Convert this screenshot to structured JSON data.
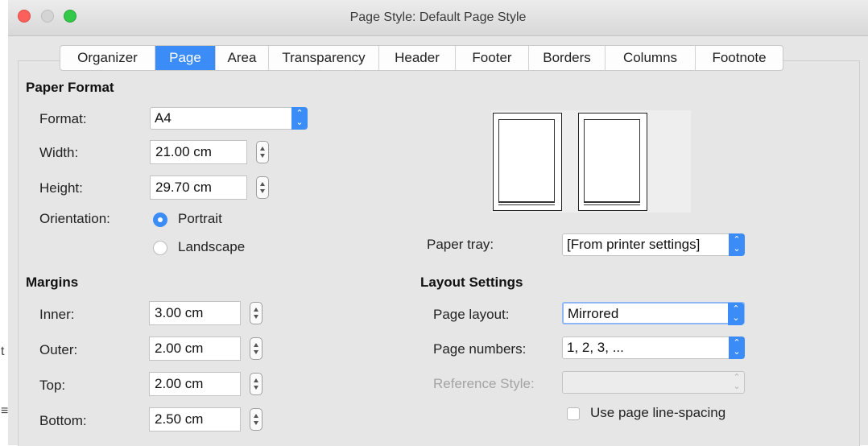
{
  "window": {
    "title": "Page Style: Default Page Style"
  },
  "tabs": [
    {
      "label": "Organizer"
    },
    {
      "label": "Page"
    },
    {
      "label": "Area"
    },
    {
      "label": "Transparency"
    },
    {
      "label": "Header"
    },
    {
      "label": "Footer"
    },
    {
      "label": "Borders"
    },
    {
      "label": "Columns"
    },
    {
      "label": "Footnote"
    }
  ],
  "paper_format": {
    "title": "Paper Format",
    "format_label": "Format:",
    "format_value": "A4",
    "width_label": "Width:",
    "width_value": "21.00 cm",
    "height_label": "Height:",
    "height_value": "29.70 cm",
    "orientation_label": "Orientation:",
    "portrait_label": "Portrait",
    "landscape_label": "Landscape",
    "paper_tray_label": "Paper tray:",
    "paper_tray_value": "[From printer settings]"
  },
  "margins": {
    "title": "Margins",
    "inner_label": "Inner:",
    "inner_value": "3.00 cm",
    "outer_label": "Outer:",
    "outer_value": "2.00 cm",
    "top_label": "Top:",
    "top_value": "2.00 cm",
    "bottom_label": "Bottom:",
    "bottom_value": "2.50 cm"
  },
  "layout_settings": {
    "title": "Layout Settings",
    "page_layout_label": "Page layout:",
    "page_layout_value": "Mirrored",
    "page_numbers_label": "Page numbers:",
    "page_numbers_value": "1, 2, 3, ...",
    "reference_style_label": "Reference Style:",
    "reference_style_value": "",
    "line_spacing_label": "Use page line-spacing"
  },
  "edge_glyphs": {
    "t": "t",
    "e": "≡"
  },
  "colors": {
    "accent": "#3b8cf6",
    "window_bg": "#e6e6e6"
  }
}
